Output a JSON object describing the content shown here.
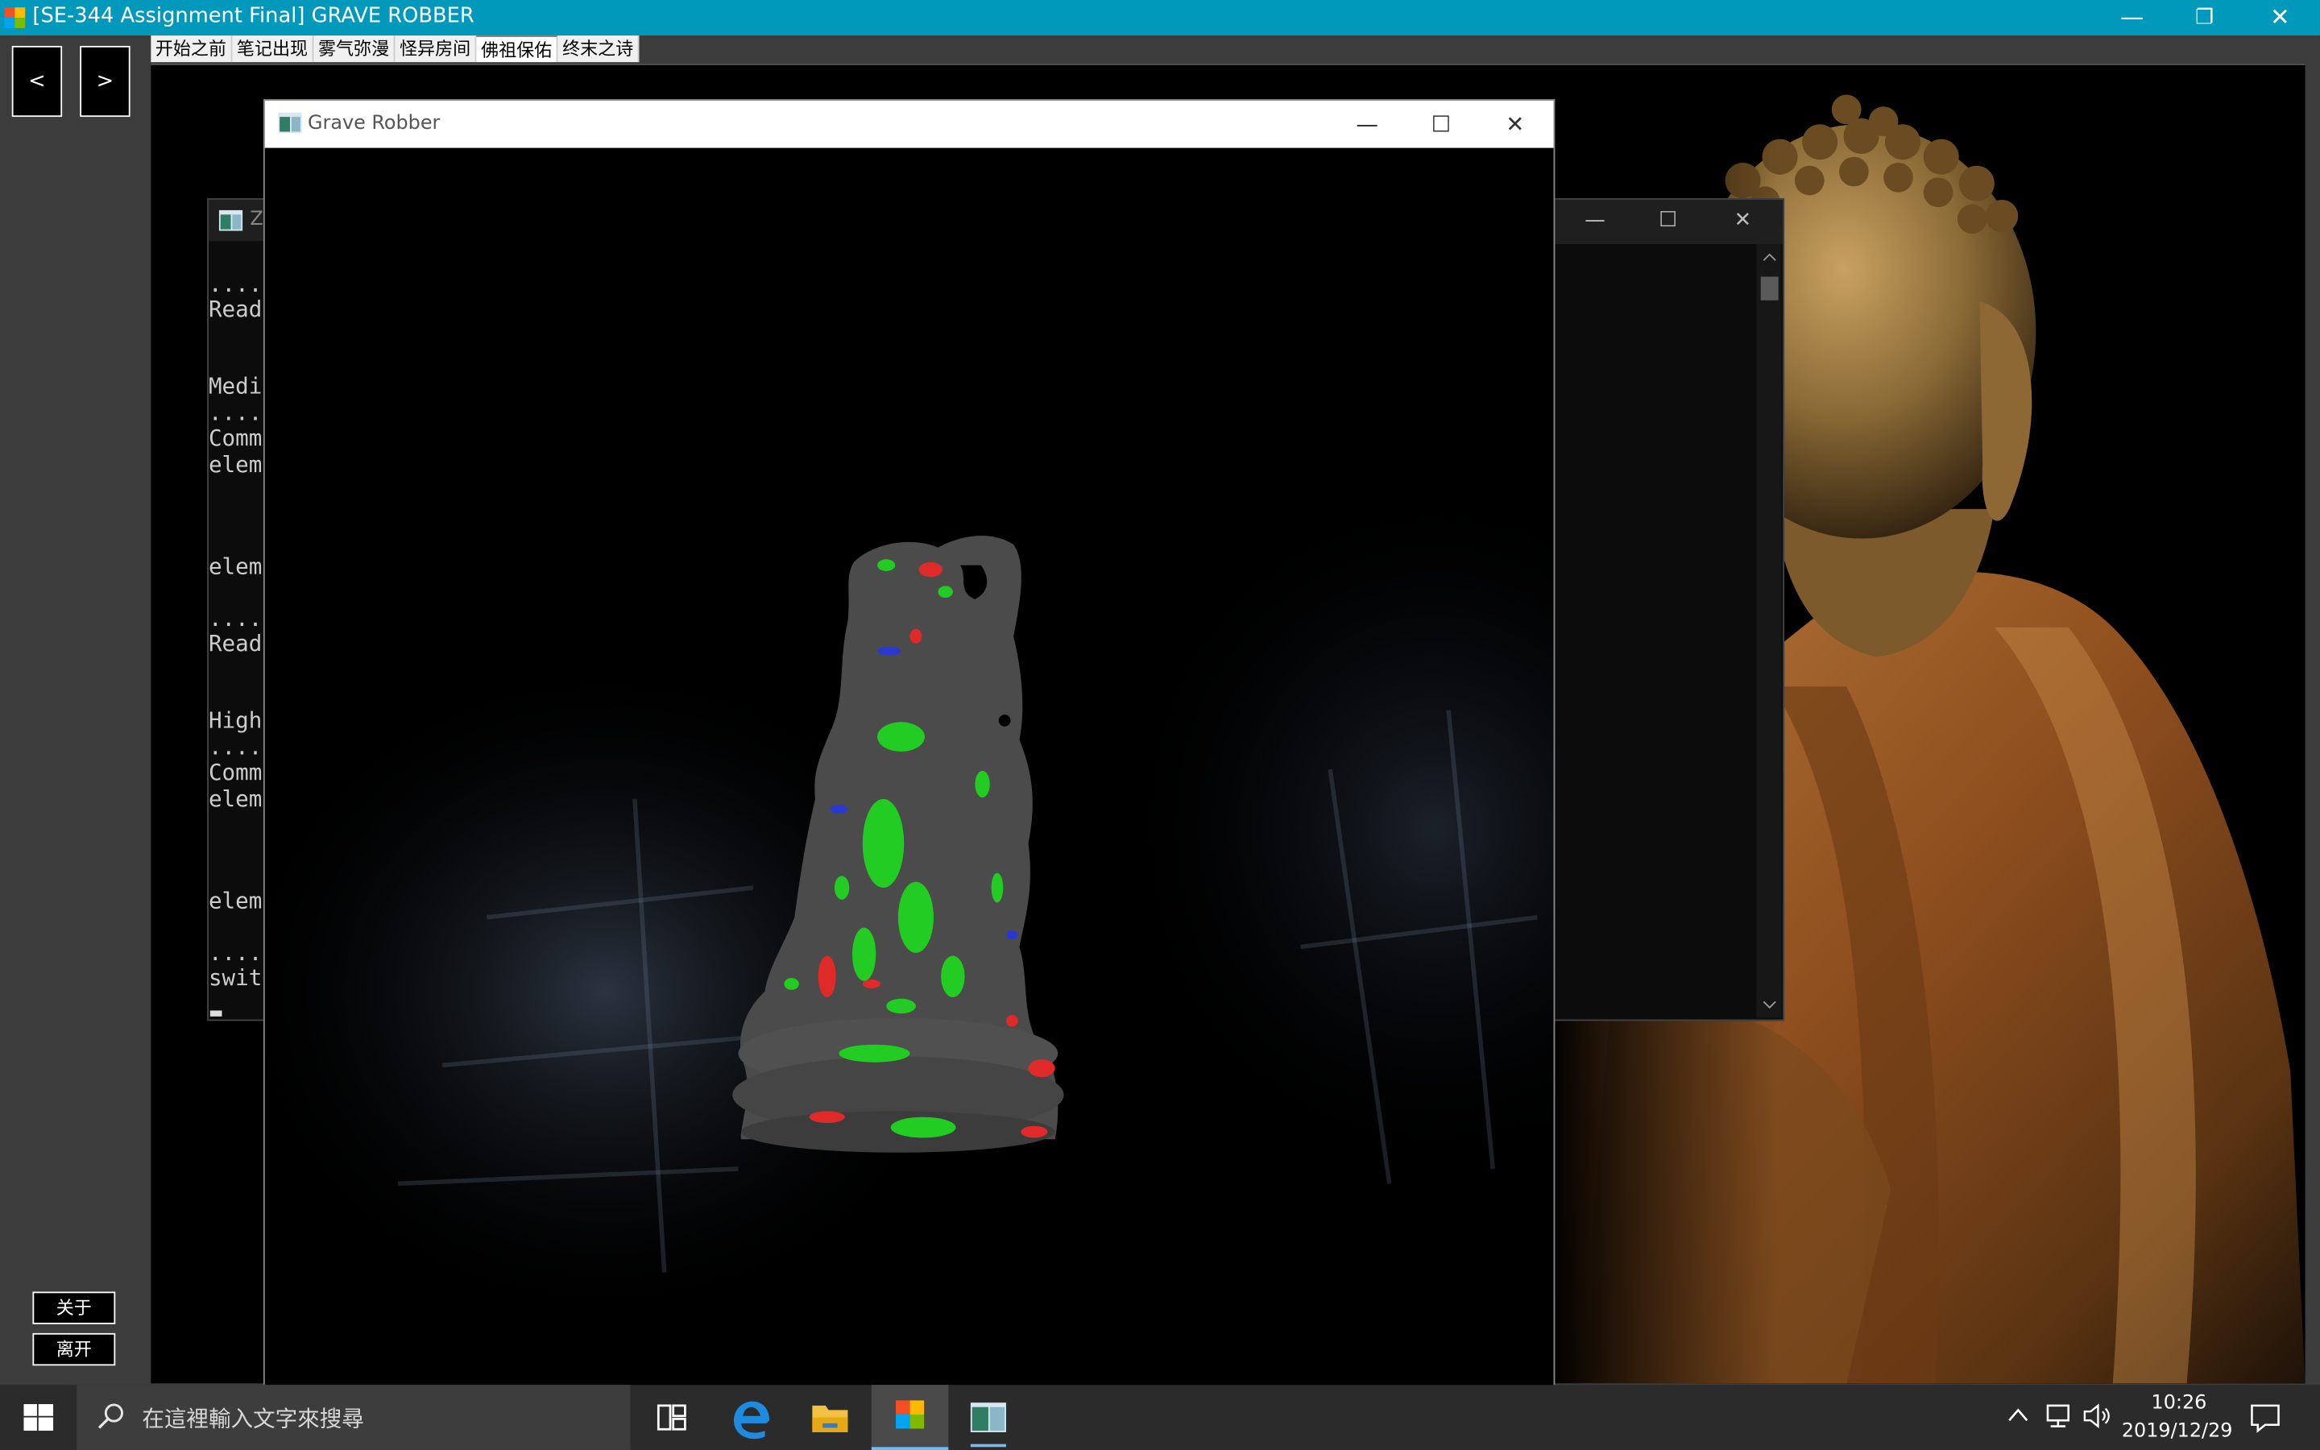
{
  "window": {
    "title": "[SE-344 Assignment Final] GRAVE ROBBER",
    "minimize_glyph": "—",
    "restore_glyph": "❐",
    "close_glyph": "✕"
  },
  "nav": {
    "prev_label": "<",
    "next_label": ">"
  },
  "scene_tabs": [
    {
      "label": "开始之前"
    },
    {
      "label": "笔记出现"
    },
    {
      "label": "雾气弥漫"
    },
    {
      "label": "怪异房间"
    },
    {
      "label": "佛祖保佑",
      "active": true
    },
    {
      "label": "终末之诗"
    }
  ],
  "side_buttons": {
    "about_label": "关于",
    "exit_label": "离开"
  },
  "console_bg": {
    "title_fragment": "Z",
    "lines": [
      "....",
      "Read",
      "Medit",
      "....",
      "Comm",
      "elem",
      "elem",
      "....",
      "Read",
      "High",
      "....",
      "Comm",
      "elem",
      "elem",
      "....",
      "swit"
    ]
  },
  "console_bg2": {
    "minimize_glyph": "—",
    "maximize_glyph": "☐",
    "close_glyph": "✕"
  },
  "render_window": {
    "title": "Grave Robber",
    "minimize_glyph": "—",
    "maximize_glyph": "☐",
    "close_glyph": "✕"
  },
  "taskbar": {
    "search_placeholder": "在這裡輸入文字來搜尋",
    "time": "10:26",
    "date": "2019/12/29"
  },
  "colors": {
    "titlebar": "#0099bc",
    "taskbar": "#2b2b2b",
    "client": "#3c3c3c",
    "statue_base": "#4b4b4b",
    "highlight_green": "#22cc22",
    "highlight_red": "#e02a2a",
    "highlight_blue": "#2a3ad0"
  }
}
